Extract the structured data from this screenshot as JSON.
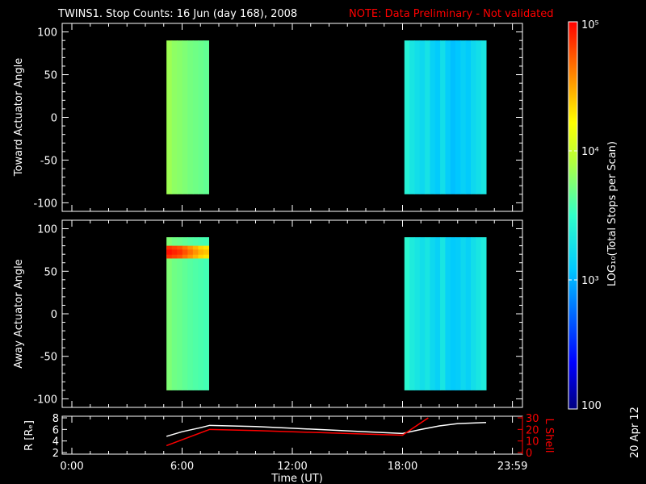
{
  "title": "TWINS1. Stop Counts: 16 Jun (day 168), 2008",
  "note": "NOTE: Data Preliminary - Not validated",
  "date_stamp": "20 Apr 12",
  "colors": {
    "note": "#ff0000",
    "r_line": "#ffffff",
    "l_line": "#ff0000",
    "background": "#000000"
  },
  "chart_data": [
    {
      "type": "heatmap",
      "name": "toward",
      "ylabel": "Toward Actuator Angle",
      "ylim": [
        -110,
        110
      ],
      "yticks": [
        100,
        50,
        0,
        -50,
        -100
      ],
      "ytick_labels": [
        "100",
        "50",
        "0",
        "-50",
        "-100"
      ],
      "xlim_hours": [
        0,
        24
      ],
      "blocks": [
        {
          "t_start": 5.15,
          "t_end": 7.45,
          "angle_range": [
            -90,
            90
          ],
          "log_values": [
            3.85,
            3.8,
            3.78,
            3.75,
            3.72,
            3.7,
            3.68,
            3.66
          ]
        },
        {
          "t_start": 18.1,
          "t_end": 22.55,
          "angle_range": [
            -90,
            90
          ],
          "log_values": [
            3.4,
            3.3,
            3.25,
            3.2,
            3.28,
            3.15,
            3.1,
            3.25,
            3.12,
            3.05,
            3.08,
            3.15,
            3.1,
            3.2,
            3.25,
            3.3
          ]
        }
      ]
    },
    {
      "type": "heatmap",
      "name": "away",
      "ylabel": "Away Actuator Angle",
      "ylim": [
        -110,
        110
      ],
      "yticks": [
        100,
        50,
        0,
        -50,
        -100
      ],
      "ytick_labels": [
        "100",
        "50",
        "0",
        "-50",
        "-100"
      ],
      "xlim_hours": [
        0,
        24
      ],
      "blocks": [
        {
          "t_start": 5.15,
          "t_end": 7.45,
          "angle_range": [
            -90,
            90
          ],
          "log_values": [
            3.75,
            3.7,
            3.68,
            3.65,
            3.62,
            3.6,
            3.58,
            3.56
          ],
          "band": {
            "angle_range": [
              65,
              80
            ],
            "log_values": [
              4.85,
              4.8,
              4.75,
              4.65,
              4.55,
              4.45,
              4.35,
              4.3
            ]
          }
        },
        {
          "t_start": 18.1,
          "t_end": 22.55,
          "angle_range": [
            -90,
            90
          ],
          "log_values": [
            3.45,
            3.35,
            3.3,
            3.25,
            3.3,
            3.2,
            3.15,
            3.3,
            3.15,
            3.1,
            3.12,
            3.2,
            3.15,
            3.25,
            3.3,
            3.35
          ]
        }
      ]
    },
    {
      "type": "line",
      "name": "orbit",
      "ylabel": "R [Rₑ]",
      "ylabel_right": "L Shell",
      "ylim": [
        2,
        8
      ],
      "yticks": [
        "2",
        "4",
        "6",
        "8"
      ],
      "ylim_right": [
        0,
        30
      ],
      "yticks_right": [
        "0",
        "10",
        "20",
        "30"
      ],
      "xlabel": "Time (UT)",
      "xticks": [
        0,
        6,
        12,
        18,
        23.983
      ],
      "xtick_labels": [
        "0:00",
        "6:00",
        "12:00",
        "18:00",
        "23:59"
      ],
      "series": [
        {
          "name": "R",
          "axis": "left",
          "x": [
            5.15,
            6.0,
            7.0,
            7.5,
            10,
            12,
            14,
            16,
            18,
            19,
            20,
            21,
            22.55
          ],
          "y": [
            4.8,
            5.6,
            6.3,
            6.7,
            6.5,
            6.2,
            5.9,
            5.6,
            5.3,
            6.0,
            6.6,
            7.0,
            7.2
          ]
        },
        {
          "name": "L Shell",
          "axis": "right",
          "x": [
            5.15,
            7.5,
            10,
            12,
            14,
            16,
            18,
            19.4
          ],
          "y": [
            6,
            20,
            19,
            18,
            17,
            16,
            15,
            30
          ]
        }
      ]
    }
  ],
  "colorbar": {
    "label": "LOG₁₀(Total Stops per Scan)",
    "range_log": [
      2,
      5
    ],
    "ticks": [
      {
        "log": 5,
        "label": "10⁵"
      },
      {
        "log": 4,
        "label": "10⁴"
      },
      {
        "log": 3,
        "label": "10³"
      },
      {
        "log": 2,
        "label": "100"
      }
    ]
  }
}
